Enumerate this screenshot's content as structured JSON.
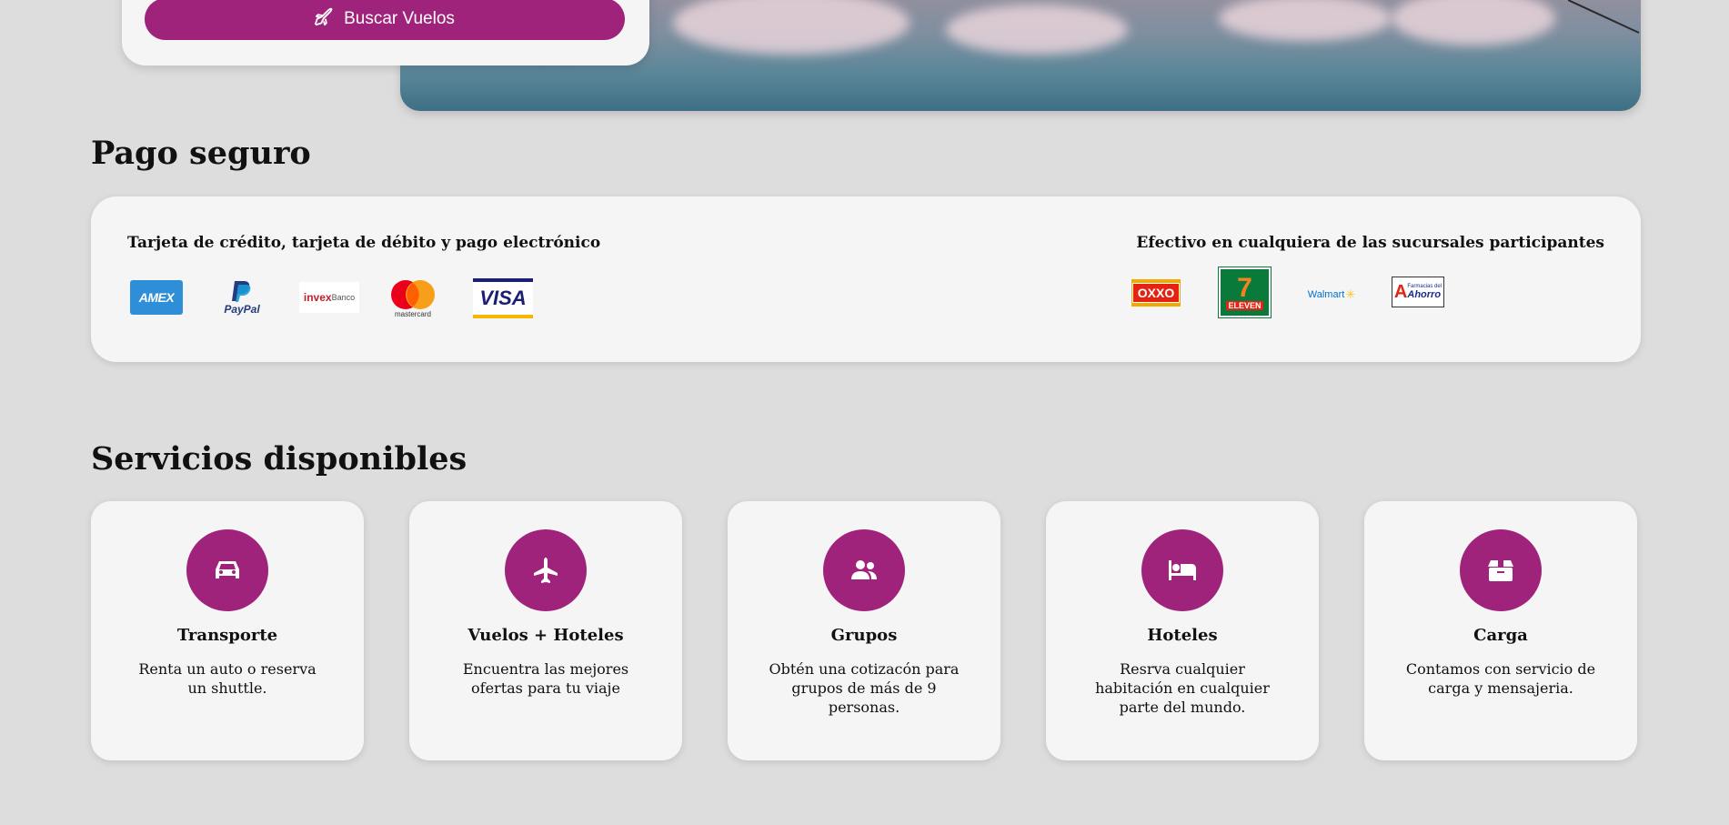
{
  "search": {
    "button_label": "Buscar Vuelos",
    "icon": "airplane-icon"
  },
  "payment": {
    "heading": "Pago seguro",
    "electronic_label": "Tarjeta de crédito, tarjeta de débito y pago electrónico",
    "cash_label": "Efectivo en cualquiera de las sucursales participantes",
    "electronic_logos": {
      "amex": "AMEX",
      "paypal_brand": "PayPal",
      "invex": "invex",
      "invex_sub": "Banco",
      "mastercard": "mastercard",
      "visa": "VISA"
    },
    "cash_logos": {
      "oxxo": "OXXO",
      "seven_number": "7",
      "seven_text": "ELEVEN",
      "walmart": "Walmart",
      "ahorro_top": "Farmacias del",
      "ahorro_main": "Ahorro",
      "ahorro_letter": "A"
    }
  },
  "services": {
    "heading": "Servicios disponibles",
    "items": [
      {
        "icon": "car-icon",
        "title": "Transporte",
        "desc": "Renta un auto o reserva un shuttle."
      },
      {
        "icon": "plane-icon",
        "title": "Vuelos + Hoteles",
        "desc": "Encuentra las mejores ofertas para tu viaje"
      },
      {
        "icon": "users-icon",
        "title": "Grupos",
        "desc": "Obtén una cotizacón para grupos de más de 9 personas."
      },
      {
        "icon": "bed-icon",
        "title": "Hoteles",
        "desc": "Resrva cualquier habitación en cualquier parte del mundo."
      },
      {
        "icon": "box-icon",
        "title": "Carga",
        "desc": "Contamos con servicio de carga y mensajeria."
      }
    ]
  },
  "colors": {
    "accent": "#a0237b",
    "background": "#dddddd",
    "card": "#f5f5f5"
  }
}
